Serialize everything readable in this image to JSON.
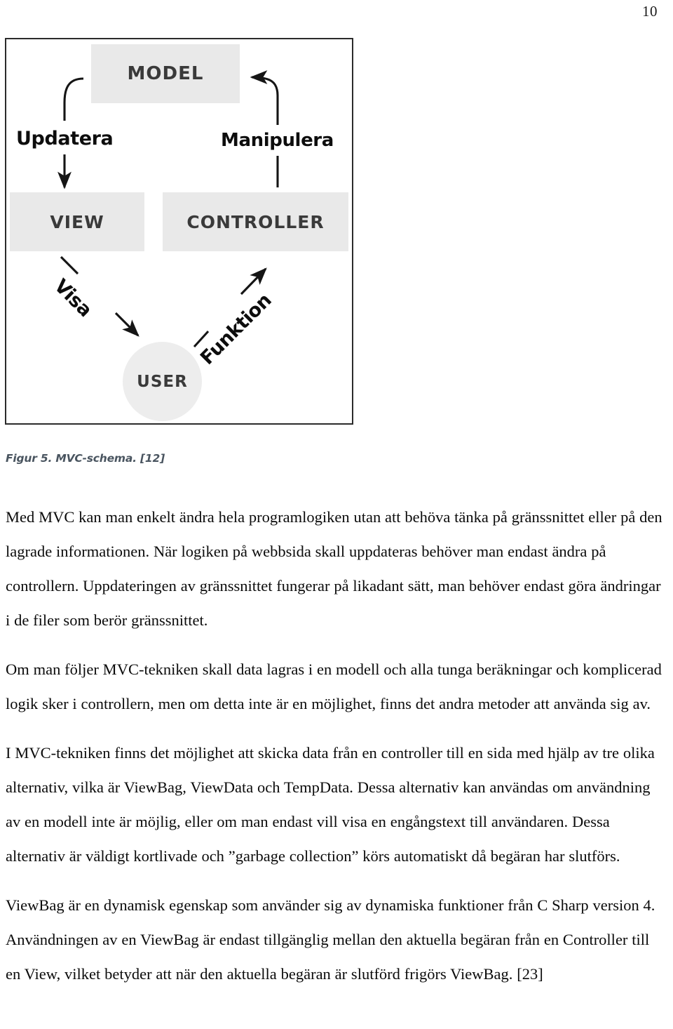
{
  "page": {
    "number": "10"
  },
  "figure": {
    "caption": "Figur 5. MVC-schema. [12]",
    "nodes": {
      "model": "MODEL",
      "view": "VIEW",
      "controller": "CONTROLLER",
      "user": "USER"
    },
    "edge_labels": {
      "updatera": "Updatera",
      "manipulera": "Manipulera",
      "visa": "Visa",
      "funktion": "Funktion"
    },
    "colors": {
      "node_fill": "#e9e9e9",
      "node_text": "#3a3a3a",
      "frame_border": "#2b2b2b",
      "arrow": "#151515",
      "caption_text": "#4a5560"
    }
  },
  "body": {
    "paragraphs": [
      "Med MVC kan man enkelt ändra hela programlogiken utan att behöva tänka på gränssnittet eller på den lagrade informationen. När logiken på webbsida skall uppdateras behöver man endast ändra på controllern. Uppdateringen av gränssnittet fungerar på likadant sätt, man behöver endast göra ändringar i de filer som berör gränssnittet.",
      "Om man följer MVC-tekniken skall data lagras i en modell och alla tunga beräkningar och komplicerad logik sker i controllern, men om detta inte är en möjlighet, finns det andra metoder att använda sig av.",
      "I MVC-tekniken finns det möjlighet att skicka data från en controller till en sida med hjälp av tre olika alternativ, vilka är ViewBag, ViewData och TempData. Dessa alternativ kan användas om användning av en modell inte är möjlig, eller om man endast vill visa en engångstext till användaren. Dessa alternativ är väldigt kortlivade och ”garbage collection” körs automatiskt då begäran har slutförs.",
      "ViewBag är en dynamisk egenskap som använder sig av dynamiska funktioner från C Sharp version 4. Användningen av en ViewBag är endast tillgänglig mellan den aktuella begäran från en Controller till en View, vilket betyder att när den aktuella begäran är slutförd frigörs ViewBag. [23]"
    ]
  }
}
